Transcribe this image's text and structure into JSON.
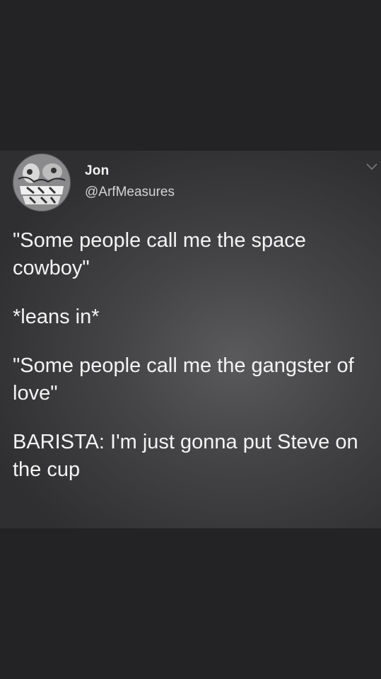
{
  "tweet": {
    "author_name": "Jon",
    "author_handle": "@ArfMeasures",
    "avatar_icon": "avatar-image",
    "menu_icon": "chevron-down-icon",
    "paragraphs": [
      "\"Some people call me the space cowboy\"",
      "*leans in*",
      "\"Some people call me the gangster of love\"",
      "BARISTA: I'm just gonna put Steve on the cup"
    ]
  },
  "colors": {
    "background": "#232325",
    "card": "#444446",
    "text": "#f4f4f4"
  }
}
